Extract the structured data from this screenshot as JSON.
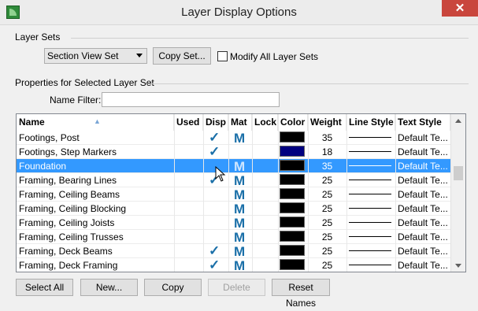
{
  "window": {
    "title": "Layer Display Options",
    "close_glyph": "✕",
    "icon": "app-icon"
  },
  "layer_sets": {
    "group_label": "Layer Sets",
    "selected_set": "Section View Set",
    "copy_set_label": "Copy Set...",
    "modify_all_label": "Modify All Layer Sets",
    "modify_all_checked": false
  },
  "properties": {
    "group_label": "Properties for Selected Layer Set",
    "name_filter_label": "Name Filter:",
    "name_filter_value": ""
  },
  "table": {
    "columns": [
      "Name",
      "Used",
      "Disp",
      "Mat",
      "Lock",
      "Color",
      "Weight",
      "Line Style",
      "Text Style"
    ],
    "rows": [
      {
        "name": "Footings, Post",
        "disp": true,
        "mat": true,
        "color": "#000000",
        "weight": "35",
        "text_style": "Default Te...",
        "selected": false
      },
      {
        "name": "Footings, Step Markers",
        "disp": true,
        "mat": false,
        "color": "#00007f",
        "weight": "18",
        "text_style": "Default Te...",
        "selected": false
      },
      {
        "name": "Foundation",
        "disp": false,
        "mat": true,
        "color": "#000000",
        "weight": "35",
        "text_style": "Default Te...",
        "selected": true
      },
      {
        "name": "Framing, Bearing Lines",
        "disp": true,
        "mat": true,
        "color": "#000000",
        "weight": "25",
        "text_style": "Default Te...",
        "selected": false
      },
      {
        "name": "Framing, Ceiling Beams",
        "disp": false,
        "mat": true,
        "color": "#000000",
        "weight": "25",
        "text_style": "Default Te...",
        "selected": false
      },
      {
        "name": "Framing, Ceiling Blocking",
        "disp": false,
        "mat": true,
        "color": "#000000",
        "weight": "25",
        "text_style": "Default Te...",
        "selected": false
      },
      {
        "name": "Framing, Ceiling Joists",
        "disp": false,
        "mat": true,
        "color": "#000000",
        "weight": "25",
        "text_style": "Default Te...",
        "selected": false
      },
      {
        "name": "Framing, Ceiling Trusses",
        "disp": false,
        "mat": true,
        "color": "#000000",
        "weight": "25",
        "text_style": "Default Te...",
        "selected": false
      },
      {
        "name": "Framing, Deck Beams",
        "disp": true,
        "mat": true,
        "color": "#000000",
        "weight": "25",
        "text_style": "Default Te...",
        "selected": false
      },
      {
        "name": "Framing, Deck Framing",
        "disp": true,
        "mat": true,
        "color": "#000000",
        "weight": "25",
        "text_style": "Default Te...",
        "selected": false
      }
    ],
    "check_glyph": "✓",
    "mat_glyph": "M"
  },
  "buttons": {
    "select_all": "Select All",
    "new": "New...",
    "copy": "Copy",
    "delete": "Delete",
    "reset_names": "Reset Names"
  },
  "colors": {
    "selection": "#3399ff",
    "icon_blue": "#1a6fa8",
    "close": "#c9463d"
  }
}
